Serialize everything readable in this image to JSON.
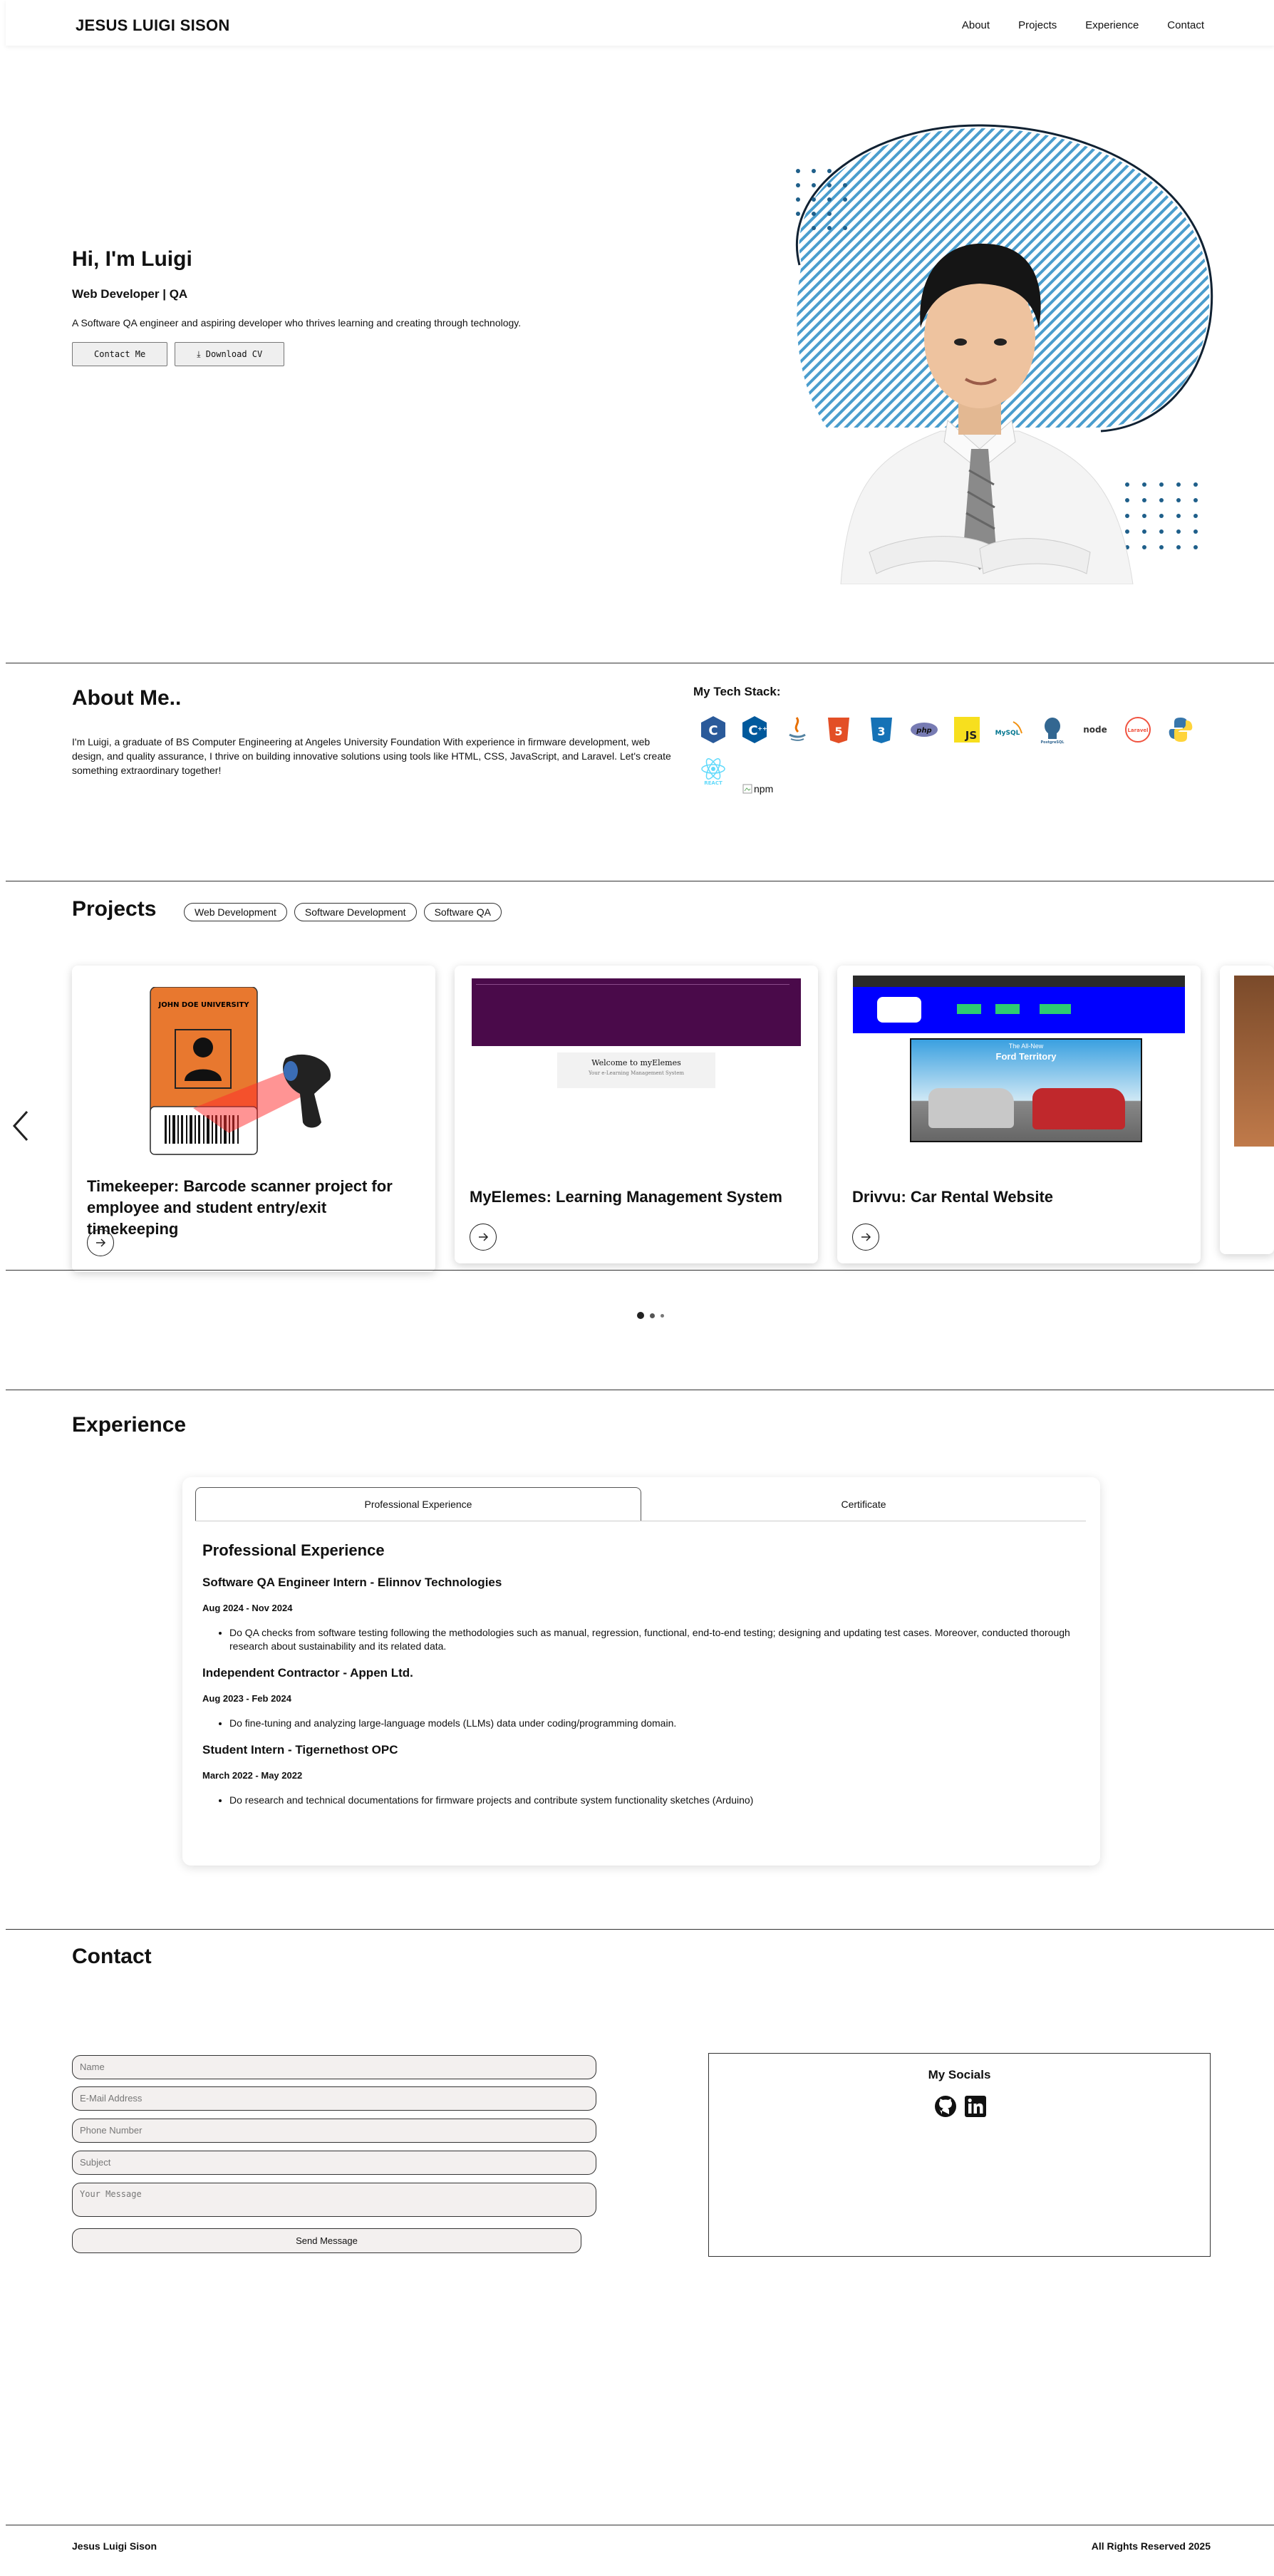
{
  "nav": {
    "brand": "JESUS LUIGI SISON",
    "links": [
      "About",
      "Projects",
      "Experience",
      "Contact"
    ]
  },
  "hero": {
    "title": "Hi, I'm Luigi",
    "role": "Web Developer | QA",
    "description": "A Software QA engineer and aspiring developer who thrives learning and creating through technology.",
    "contact_button": "Contact Me",
    "download_button": "⤓ Download CV"
  },
  "about": {
    "title": "About Me..",
    "text": "I'm Luigi, a graduate of BS Computer Engineering at Angeles University Foundation With experience in firmware development, web design, and quality assurance, I thrive on building innovative solutions using tools like HTML, CSS, JavaScript, and Laravel. Let's create something extraordinary together!",
    "tech_title": "My Tech Stack:",
    "tech_icons": [
      "c-icon",
      "cpp-icon",
      "java-icon",
      "html5-icon",
      "css3-icon",
      "php-icon",
      "javascript-icon",
      "mysql-icon",
      "postgresql-icon",
      "nodejs-icon",
      "laravel-icon",
      "python-icon",
      "react-icon"
    ],
    "npm_alt": "npm"
  },
  "projects": {
    "title": "Projects",
    "filters": [
      "Web Development",
      "Software Development",
      "Software QA"
    ],
    "cards": [
      {
        "title": "Timekeeper: Barcode scanner project for employee and student entry/exit timekeeping",
        "badge": "JOHN DOE UNIVERSITY"
      },
      {
        "title": "MyElemes: Learning Management System",
        "screen_heading": "Welcome to myElemes",
        "screen_sub": "Your e-Learning Management System"
      },
      {
        "title": "Drivvu: Car Rental Website",
        "screen_heading": "The All-New",
        "screen_sub": "Ford Territory"
      }
    ]
  },
  "experience": {
    "title": "Experience",
    "tabs": [
      "Professional Experience",
      "Certificate"
    ],
    "heading": "Professional Experience",
    "jobs": [
      {
        "title": "Software QA Engineer Intern - Elinnov Technologies",
        "date": "Aug 2024 - Nov 2024",
        "bullet": "Do QA checks from software testing following the methodologies such as manual, regression, functional, end-to-end testing; designing and updating test cases. Moreover, conducted thorough research about sustainability and its related data."
      },
      {
        "title": "Independent Contractor - Appen Ltd.",
        "date": "Aug 2023 - Feb 2024",
        "bullet": "Do fine-tuning and analyzing large-language models (LLMs) data under coding/programming domain."
      },
      {
        "title": "Student Intern - Tigernethost OPC",
        "date": "March 2022 - May 2022",
        "bullet": "Do research and technical documentations for firmware projects and contribute system functionality sketches (Arduino)"
      }
    ]
  },
  "contact": {
    "title": "Contact",
    "placeholders": {
      "name": "Name",
      "email": "E-Mail Address",
      "phone": "Phone Number",
      "subject": "Subject",
      "message": "Your Message"
    },
    "send_button": "Send Message",
    "socials_title": "My Socials",
    "social_icons": [
      "github-icon",
      "linkedin-icon"
    ]
  },
  "footer": {
    "name": "Jesus Luigi Sison",
    "rights": "All Rights Reserved 2025"
  },
  "colors": {
    "accent_blue": "#1f7fb8",
    "text": "#111111",
    "card_orange": "#e8782f",
    "lms_purple": "#4a0a4a",
    "rental_blue": "#0000ff"
  }
}
